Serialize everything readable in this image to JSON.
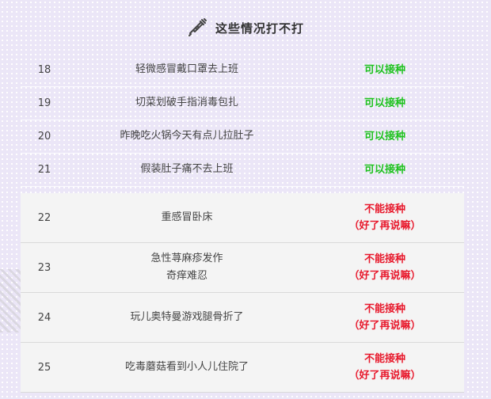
{
  "header": {
    "title": "这些情况打不打",
    "icon": "syringe-icon"
  },
  "rows": [
    {
      "num": "18",
      "desc": "轻微感冒戴口罩去上班",
      "verdict": "可以接种"
    },
    {
      "num": "19",
      "desc": "切菜划破手指消毒包扎",
      "verdict": "可以接种"
    },
    {
      "num": "20",
      "desc": "昨晚吃火锅今天有点儿拉肚子",
      "verdict": "可以接种"
    },
    {
      "num": "21",
      "desc": "假装肚子痛不去上班",
      "verdict": "可以接种"
    },
    {
      "num": "22",
      "desc": "重感冒卧床",
      "desc2": "",
      "verdict": "不能接种",
      "verdict2": "（好了再说嘛）"
    },
    {
      "num": "23",
      "desc": "急性荨麻疹发作",
      "desc2": "奇痒难忍",
      "verdict": "不能接种",
      "verdict2": "（好了再说嘛）"
    },
    {
      "num": "24",
      "desc": "玩儿奥特曼游戏腿骨折了",
      "desc2": "",
      "verdict": "不能接种",
      "verdict2": "（好了再说嘛）"
    },
    {
      "num": "25",
      "desc": "吃毒蘑菇看到小人儿住院了",
      "desc2": "",
      "verdict": "不能接种",
      "verdict2": "（好了再说嘛）"
    }
  ],
  "colors": {
    "ok": "#1fc21f",
    "no": "#e8192c",
    "background": "#ebe6f7",
    "panel": "#f4f4f4"
  }
}
